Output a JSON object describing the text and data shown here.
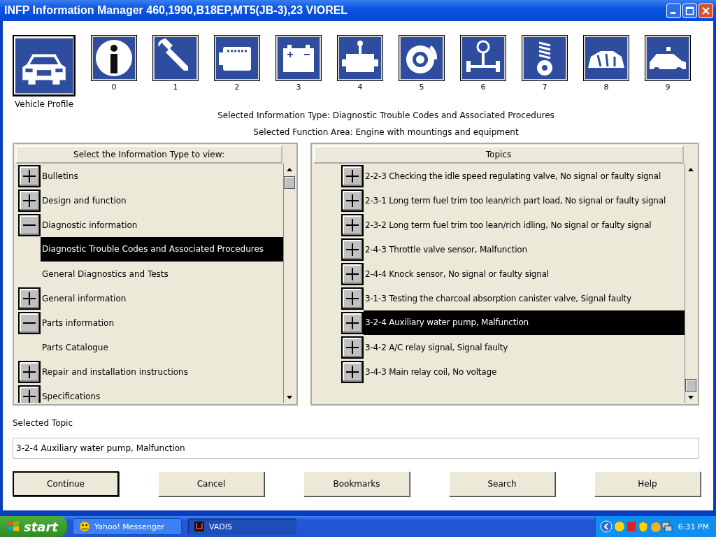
{
  "window": {
    "title": "INFP Information Manager 460,1990,B18EP,MT5(JB-3),23 VIOREL"
  },
  "vehicle_profile": {
    "label": "Vehicle Profile"
  },
  "function_areas": [
    {
      "label": "0"
    },
    {
      "label": "1"
    },
    {
      "label": "2"
    },
    {
      "label": "3"
    },
    {
      "label": "4"
    },
    {
      "label": "5"
    },
    {
      "label": "6"
    },
    {
      "label": "7"
    },
    {
      "label": "8"
    },
    {
      "label": "9"
    }
  ],
  "selected_info_type": "Selected Information Type: Diagnostic Trouble Codes and Associated Procedures",
  "selected_function_area": "Selected Function Area: Engine with mountings and equipment",
  "info_types": {
    "header": "Select the Information Type to view:",
    "items": [
      {
        "label": "Bulletins",
        "expanded": false,
        "selected": false
      },
      {
        "label": "Design and function",
        "expanded": false,
        "selected": false
      },
      {
        "label": "Diagnostic information",
        "expanded": true,
        "selected": false,
        "children": [
          {
            "label": "Diagnostic Trouble Codes and Associated Procedures",
            "selected": true
          },
          {
            "label": "General Diagnostics and Tests",
            "selected": false
          }
        ]
      },
      {
        "label": "General information",
        "expanded": false,
        "selected": false
      },
      {
        "label": "Parts information",
        "expanded": true,
        "selected": false,
        "children": [
          {
            "label": "Parts Catalogue",
            "selected": false
          }
        ]
      },
      {
        "label": "Repair and installation instructions",
        "expanded": false,
        "selected": false
      },
      {
        "label": "Specifications",
        "expanded": false,
        "selected": false
      }
    ]
  },
  "topics": {
    "header": "Topics",
    "items": [
      {
        "label": "2-2-3 Checking the idle speed regulating valve, No signal or faulty signal",
        "expanded": false,
        "selected": false
      },
      {
        "label": "2-3-1 Long term fuel trim too lean/rich part load, No signal or faulty signal",
        "expanded": false,
        "selected": false
      },
      {
        "label": "2-3-2 Long term fuel trim too lean/rich idling, No signal or faulty signal",
        "expanded": false,
        "selected": false
      },
      {
        "label": "2-4-3 Throttle valve sensor, Malfunction",
        "expanded": false,
        "selected": false
      },
      {
        "label": "2-4-4 Knock sensor, No signal or faulty signal",
        "expanded": false,
        "selected": false
      },
      {
        "label": "3-1-3 Testing the charcoal absorption canister valve, Signal faulty",
        "expanded": false,
        "selected": false
      },
      {
        "label": "3-2-4 Auxiliary water pump, Malfunction",
        "expanded": false,
        "selected": true
      },
      {
        "label": "3-4-2 A/C relay signal, Signal faulty",
        "expanded": false,
        "selected": false
      },
      {
        "label": "3-4-3 Main relay coil, No voltage",
        "expanded": false,
        "selected": false
      }
    ]
  },
  "selected_topic": {
    "label": "Selected Topic",
    "value": "3-2-4 Auxiliary water pump, Malfunction"
  },
  "buttons": [
    {
      "label": "Continue",
      "default": true
    },
    {
      "label": "Cancel",
      "default": false
    },
    {
      "label": "Bookmarks",
      "default": false
    },
    {
      "label": "Search",
      "default": false
    },
    {
      "label": "Help",
      "default": false
    }
  ],
  "taskbar": {
    "start": "start",
    "tasks": [
      {
        "label": "Yahoo! Messenger",
        "selected": false
      },
      {
        "label": "VADIS",
        "selected": true
      }
    ],
    "clock": "6:31 PM"
  }
}
